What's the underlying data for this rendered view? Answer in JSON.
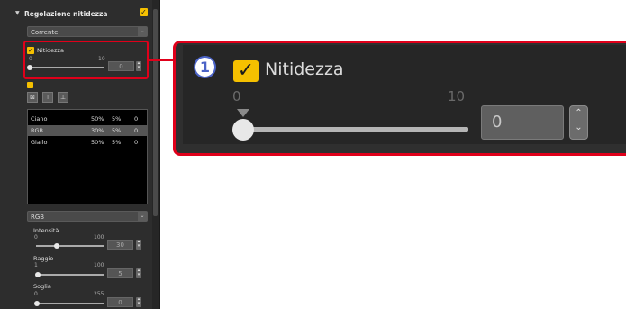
{
  "panel": {
    "section_title": "Regolazione nitidezza",
    "preset_value": "Corrente",
    "nitidezza": {
      "label": "Nitidezza",
      "min": "0",
      "max": "10",
      "value": "0",
      "level": 0
    },
    "channel_list": {
      "rows": [
        {
          "name": "Ciano",
          "c1": "50%",
          "c2": "5%",
          "c3": "0"
        },
        {
          "name": "RGB",
          "c1": "30%",
          "c2": "5%",
          "c3": "0"
        },
        {
          "name": "Giallo",
          "c1": "50%",
          "c2": "5%",
          "c3": "0"
        }
      ],
      "selected_index": 1
    },
    "channel_select": "RGB",
    "intensita": {
      "label": "Intensità",
      "min": "0",
      "max": "100",
      "value": "30",
      "level": 0.3
    },
    "raggio": {
      "label": "Raggio",
      "min": "1",
      "max": "100",
      "value": "5",
      "level": 0.04
    },
    "soglia": {
      "label": "Soglia",
      "min": "0",
      "max": "255",
      "value": "0",
      "level": 0
    }
  },
  "zoom": {
    "callout_number": "1",
    "label": "Nitidezza",
    "min": "0",
    "max": "10",
    "value": "0",
    "level": 0
  },
  "colors": {
    "accent_red": "#e0001a",
    "checkbox_yellow": "#f5c000",
    "callout_blue": "#4b63c7"
  },
  "icons": {
    "checkbox": "check-icon",
    "spinner": "up-down-arrows-icon",
    "dropdown": "chevron-down-icon",
    "collapse": "triangle-down-icon"
  }
}
